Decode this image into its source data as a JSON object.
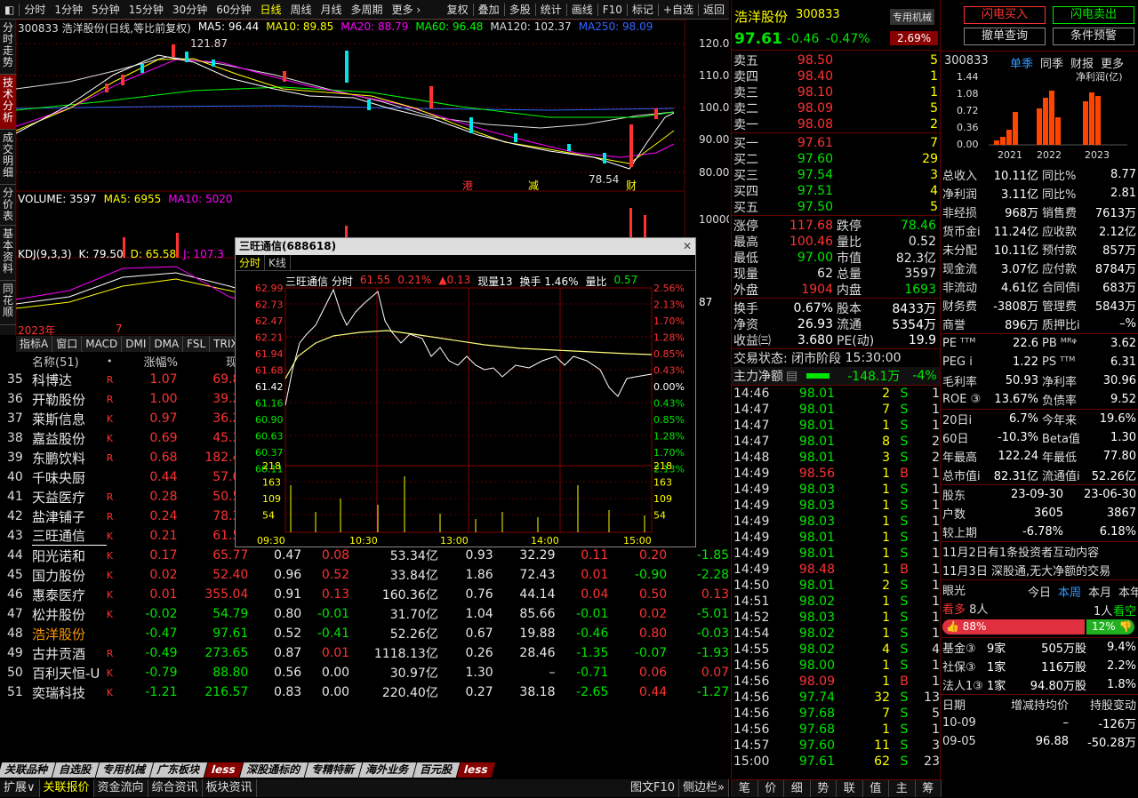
{
  "topbar": {
    "items": [
      "分时",
      "1分钟",
      "5分钟",
      "15分钟",
      "30分钟",
      "60分钟",
      "日线",
      "周线",
      "月线",
      "多周期",
      "更多"
    ],
    "tools": [
      "复权",
      "叠加",
      "多股",
      "统计",
      "画线",
      "F10",
      "标记",
      "+自选",
      "返回"
    ]
  },
  "lefttabs": [
    "分时走势",
    "技术分析",
    "成交明细",
    "分价表",
    "基本资料",
    "同花顺"
  ],
  "chart": {
    "title": "300833 浩洋股份(日线,等比前复权)",
    "ma": [
      {
        "name": "MA5: 96.44",
        "color": "#ffffff"
      },
      {
        "name": "MA10: 89.85",
        "color": "#ffff00"
      },
      {
        "name": "MA20: 88.79",
        "color": "#ff00ff"
      },
      {
        "name": "MA60: 96.48",
        "color": "#00ff00"
      },
      {
        "name": "MA120: 102.37",
        "color": "#e0e0e0"
      },
      {
        "name": "MA250: 98.09",
        "color": "#3366ff"
      }
    ],
    "yticks": [
      "120.00",
      "110.00",
      "100.00",
      "90.00",
      "80.00"
    ],
    "high": "121.87",
    "low": "78.54",
    "markers": [
      "港",
      "减",
      "财"
    ],
    "vol": "VOLUME: 3597",
    "vma5": "MA5: 6955",
    "vma10": "MA10: 5020",
    "vtick": "10000",
    "kdj": "KDJ(9,3,3)",
    "k": "K: 79.50",
    "d": "D: 65.58",
    "j": "J: 107.3",
    "year": "2023年",
    "month": "7",
    "right_price": "87"
  },
  "subtabs": [
    "指标A",
    "窗口",
    "MACD",
    "DMI",
    "DMA",
    "FSL",
    "TRIX"
  ],
  "list": {
    "headers": [
      "名称(51)",
      "•",
      "涨幅%",
      "现价"
    ],
    "rows": [
      {
        "n": "35",
        "name": "科博达",
        "tag": "R",
        "pct": "1.07",
        "price": "69.85",
        "a": "",
        "b": "",
        "cap": "",
        "d": "",
        "e": "",
        "f": "",
        "g": "",
        "h": ""
      },
      {
        "n": "36",
        "name": "开勒股份",
        "tag": "R",
        "pct": "1.00",
        "price": "39.29",
        "a": "",
        "b": "",
        "cap": "",
        "d": "",
        "e": "",
        "f": "",
        "g": "",
        "h": ""
      },
      {
        "n": "37",
        "name": "莱斯信息",
        "tag": "K",
        "pct": "0.97",
        "price": "36.25",
        "a": "",
        "b": "",
        "cap": "",
        "d": "",
        "e": "",
        "f": "",
        "g": "",
        "h": ""
      },
      {
        "n": "38",
        "name": "嘉益股份",
        "tag": "K",
        "pct": "0.69",
        "price": "45.30",
        "a": "",
        "b": "",
        "cap": "",
        "d": "",
        "e": "",
        "f": "",
        "g": "",
        "h": ""
      },
      {
        "n": "39",
        "name": "东鹏饮料",
        "tag": "R",
        "pct": "0.68",
        "price": "182.49",
        "a": "",
        "b": "",
        "cap": "",
        "d": "",
        "e": "",
        "f": "",
        "g": "",
        "h": ""
      },
      {
        "n": "40",
        "name": "千味央厨",
        "tag": "",
        "pct": "0.44",
        "price": "57.05",
        "a": "",
        "b": "",
        "cap": "",
        "d": "",
        "e": "",
        "f": "",
        "g": "",
        "h": ""
      },
      {
        "n": "41",
        "name": "天益医疗",
        "tag": "R",
        "pct": "0.28",
        "price": "50.55",
        "a": "",
        "b": "",
        "cap": "",
        "d": "",
        "e": "",
        "f": "",
        "g": "",
        "h": ""
      },
      {
        "n": "42",
        "name": "盐津铺子",
        "tag": "R",
        "pct": "0.24",
        "price": "78.37",
        "a": "",
        "b": "",
        "cap": "",
        "d": "",
        "e": "",
        "f": "",
        "g": "",
        "h": ""
      },
      {
        "n": "43",
        "name": "三旺通信",
        "tag": "K",
        "pct": "0.21",
        "price": "61.55",
        "a": "",
        "b": "",
        "cap": "",
        "d": "",
        "e": "",
        "f": "",
        "g": "",
        "h": ""
      },
      {
        "n": "44",
        "name": "阳光诺和",
        "tag": "K",
        "pct": "0.17",
        "price": "65.77",
        "a": "0.47",
        "b": "0.08",
        "cap": "53.34亿",
        "d": "0.93",
        "e": "32.29",
        "f": "0.11",
        "g": "0.20",
        "h": "-1.85"
      },
      {
        "n": "45",
        "name": "国力股份",
        "tag": "K",
        "pct": "0.02",
        "price": "52.40",
        "a": "0.96",
        "b": "0.52",
        "cap": "33.84亿",
        "d": "1.86",
        "e": "72.43",
        "f": "0.01",
        "g": "-0.90",
        "h": "-2.28"
      },
      {
        "n": "46",
        "name": "惠泰医疗",
        "tag": "K",
        "pct": "0.01",
        "price": "355.04",
        "a": "0.91",
        "b": "0.13",
        "cap": "160.36亿",
        "d": "0.76",
        "e": "44.14",
        "f": "0.04",
        "g": "0.50",
        "h": "0.13"
      },
      {
        "n": "47",
        "name": "松井股份",
        "tag": "K",
        "pct": "-0.02",
        "price": "54.79",
        "a": "0.80",
        "b": "-0.01",
        "cap": "31.70亿",
        "d": "1.04",
        "e": "85.66",
        "f": "-0.01",
        "g": "0.02",
        "h": "-5.01"
      },
      {
        "n": "48",
        "name": "浩洋股份",
        "tag": "",
        "pct": "-0.47",
        "price": "97.61",
        "a": "0.52",
        "b": "-0.41",
        "cap": "52.26亿",
        "d": "0.67",
        "e": "19.88",
        "f": "-0.46",
        "g": "0.80",
        "h": "-0.03"
      },
      {
        "n": "49",
        "name": "古井贡酒",
        "tag": "R",
        "pct": "-0.49",
        "price": "273.65",
        "a": "0.87",
        "b": "0.01",
        "cap": "1118.13亿",
        "d": "0.26",
        "e": "28.46",
        "f": "-1.35",
        "g": "-0.07",
        "h": "-1.93"
      },
      {
        "n": "50",
        "name": "百利天恒-U",
        "tag": "K",
        "pct": "-0.79",
        "price": "88.80",
        "a": "0.56",
        "b": "0.00",
        "cap": "30.97亿",
        "d": "1.30",
        "e": "–",
        "f": "-0.71",
        "g": "0.06",
        "h": "0.07"
      },
      {
        "n": "51",
        "name": "奕瑞科技",
        "tag": "K",
        "pct": "-1.21",
        "price": "216.57",
        "a": "0.83",
        "b": "0.00",
        "cap": "220.40亿",
        "d": "0.27",
        "e": "38.18",
        "f": "-2.65",
        "g": "0.44",
        "h": "-1.27"
      }
    ]
  },
  "btmtabs": [
    "关联品种",
    "自选股",
    "专用机械",
    "广东板块",
    "less",
    "深股通标的",
    "专精特新",
    "海外业务",
    "百元股",
    "less"
  ],
  "btm2": [
    "扩展∨",
    "关联报价",
    "资金流向",
    "综合资讯",
    "板块资讯"
  ],
  "btm2r": [
    "图文F10",
    "侧边栏»"
  ],
  "popup": {
    "title": "三旺通信(688618)",
    "tabs": [
      "分时",
      "K线"
    ],
    "info": "三旺通信 分时",
    "price": "61.55",
    "pct": "0.21%",
    "chg": "▲0.13",
    "vol": "现量13",
    "turn": "换手 1.46%",
    "vr": "量比",
    "vrv": "0.57",
    "lticks": [
      "62.99",
      "62.73",
      "62.47",
      "62.21",
      "61.94",
      "61.68",
      "61.42",
      "61.16",
      "60.90",
      "60.63",
      "60.37",
      "60.11"
    ],
    "rticks": [
      "2.56%",
      "2.13%",
      "1.70%",
      "1.28%",
      "0.85%",
      "0.43%",
      "0.00%",
      "0.43%",
      "0.85%",
      "1.28%",
      "1.70%",
      "2.13%"
    ],
    "vticks": [
      "218",
      "163",
      "109",
      "54"
    ],
    "times": [
      "09:30",
      "10:30",
      "13:00",
      "14:00",
      "15:00"
    ]
  },
  "stock": {
    "name": "浩洋股份",
    "code": "300833",
    "badge": "专用机械",
    "price": "97.61",
    "chg": "-0.46",
    "pct": "-0.47%",
    "badgepct": "2.69%"
  },
  "asks": [
    {
      "l": "卖五",
      "p": "98.50",
      "v": "5"
    },
    {
      "l": "卖四",
      "p": "98.40",
      "v": "1"
    },
    {
      "l": "卖三",
      "p": "98.10",
      "v": "1"
    },
    {
      "l": "卖二",
      "p": "98.09",
      "v": "5"
    },
    {
      "l": "卖一",
      "p": "98.08",
      "v": "2"
    }
  ],
  "bids": [
    {
      "l": "买一",
      "p": "97.61",
      "v": "7"
    },
    {
      "l": "买二",
      "p": "97.60",
      "v": "29"
    },
    {
      "l": "买三",
      "p": "97.54",
      "v": "3"
    },
    {
      "l": "买四",
      "p": "97.51",
      "v": "4"
    },
    {
      "l": "买五",
      "p": "97.50",
      "v": "5"
    }
  ],
  "quote": [
    {
      "a": "涨停",
      "av": "117.68",
      "ac": "red",
      "b": "跌停",
      "bv": "78.46",
      "bc": "grn"
    },
    {
      "a": "最高",
      "av": "100.46",
      "ac": "red",
      "b": "量比",
      "bv": "0.52",
      "bc": "wht"
    },
    {
      "a": "最低",
      "av": "97.00",
      "ac": "grn",
      "b": "市值",
      "bv": "82.3亿",
      "bc": "wht"
    },
    {
      "a": "现量",
      "av": "62",
      "ac": "wht",
      "b": "总量",
      "bv": "3597",
      "bc": "wht"
    },
    {
      "a": "外盘",
      "av": "1904",
      "ac": "red",
      "b": "内盘",
      "bv": "1693",
      "bc": "grn"
    }
  ],
  "quote2": [
    {
      "a": "换手",
      "av": "0.67%",
      "b": "股本",
      "bv": "8433万"
    },
    {
      "a": "净资",
      "av": "26.93",
      "b": "流通",
      "bv": "5354万"
    },
    {
      "a": "收益㈢",
      "av": "3.680",
      "b": "PE(动)",
      "bv": "19.9"
    }
  ],
  "status": {
    "label": "交易状态: 闭市阶段",
    "time": "15:30:00",
    "flow_label": "主力净额",
    "flow": "-148.1万",
    "flow_pct": "-4%"
  },
  "ticks": [
    [
      "14:46",
      "98.01",
      "2",
      "S",
      "1"
    ],
    [
      "14:47",
      "98.01",
      "7",
      "S",
      "1"
    ],
    [
      "14:47",
      "98.01",
      "1",
      "S",
      "1"
    ],
    [
      "14:47",
      "98.01",
      "8",
      "S",
      "2"
    ],
    [
      "14:48",
      "98.01",
      "3",
      "S",
      "2"
    ],
    [
      "14:49",
      "98.56",
      "1",
      "B",
      "1"
    ],
    [
      "14:49",
      "98.03",
      "1",
      "S",
      "1"
    ],
    [
      "14:49",
      "98.03",
      "1",
      "S",
      "1"
    ],
    [
      "14:49",
      "98.03",
      "1",
      "S",
      "1"
    ],
    [
      "14:49",
      "98.01",
      "1",
      "S",
      "1"
    ],
    [
      "14:49",
      "98.01",
      "1",
      "S",
      "1"
    ],
    [
      "14:49",
      "98.48",
      "1",
      "B",
      "1"
    ],
    [
      "14:50",
      "98.01",
      "2",
      "S",
      "1"
    ],
    [
      "14:51",
      "98.02",
      "1",
      "S",
      "1"
    ],
    [
      "14:52",
      "98.03",
      "1",
      "S",
      "1"
    ],
    [
      "14:54",
      "98.02",
      "1",
      "S",
      "1"
    ],
    [
      "14:55",
      "98.02",
      "4",
      "S",
      "4"
    ],
    [
      "14:56",
      "98.00",
      "1",
      "S",
      "1"
    ],
    [
      "14:56",
      "98.09",
      "1",
      "B",
      "1"
    ],
    [
      "14:56",
      "97.74",
      "32",
      "S",
      "13"
    ],
    [
      "14:56",
      "97.68",
      "7",
      "S",
      "5"
    ],
    [
      "14:56",
      "97.68",
      "1",
      "S",
      "1"
    ],
    [
      "14:57",
      "97.60",
      "11",
      "S",
      "3"
    ],
    [
      "15:00",
      "97.61",
      "62",
      "S",
      "23"
    ]
  ],
  "midbottom": [
    "笔",
    "价",
    "细",
    "势",
    "联",
    "值",
    "主",
    "筹"
  ],
  "right": {
    "btns": [
      "闪电买入",
      "闪电卖出",
      "撤单查询",
      "条件预警"
    ],
    "code": "300833",
    "tabs": [
      "单季",
      "同季",
      "财报",
      "更多"
    ],
    "chart_label": "净利润(亿)",
    "yticks": [
      "1.44",
      "1.08",
      "0.72",
      "0.36",
      "0.00"
    ],
    "years": [
      "2021",
      "2022",
      "2023"
    ],
    "fin": [
      [
        "总收入",
        "10.11亿",
        "同比%",
        "8.77"
      ],
      [
        "净利润",
        "3.11亿",
        "同比%",
        "2.81"
      ],
      [
        "非经损",
        "968万",
        "销售费",
        "7613万"
      ],
      [
        "货币金i",
        "11.24亿",
        "应收款",
        "2.12亿"
      ],
      [
        "未分配",
        "10.11亿",
        "预付款",
        "857万"
      ],
      [
        "现金流",
        "3.07亿",
        "应付款",
        "8784万"
      ],
      [
        "非流动",
        "4.61亿",
        "合同债i",
        "683万"
      ],
      [
        "财务费",
        "-3808万",
        "管理费",
        "5843万"
      ],
      [
        "商誉",
        "896万",
        "质押比i",
        "–%"
      ]
    ],
    "ratios": [
      [
        "PE ᵀᵀᴹ",
        "22.6",
        "PB ᴹᴿᵠ",
        "3.62"
      ],
      [
        "PEG i",
        "1.22",
        "PS ᵀᵀᴹ",
        "6.31"
      ],
      [
        "毛利率",
        "50.93",
        "净利率",
        "30.96"
      ],
      [
        "ROE ③",
        "13.67%",
        "负债率",
        "9.52"
      ]
    ],
    "perf": [
      [
        "20日i",
        "6.7%",
        "今年来",
        "19.6%"
      ],
      [
        "60日",
        "-10.3%",
        "Beta值",
        "1.30"
      ],
      [
        "年最高",
        "122.24",
        "年最低",
        "77.80"
      ],
      [
        "总市值i",
        "82.31亿",
        "流通值i",
        "52.26亿"
      ]
    ],
    "holders": [
      [
        "股东",
        "23-09-30",
        "23-06-30"
      ],
      [
        "户数",
        "3605",
        "3867"
      ],
      [
        "较上期",
        "-6.78%",
        "6.18%"
      ]
    ],
    "news": [
      "11月2日有1条投资者互动内容",
      "11月3日 深股通,无大净额的交易"
    ],
    "opinion": {
      "label": "眼光",
      "tabs": [
        "今日",
        "本周",
        "本月",
        "本年"
      ],
      "bull": "看多",
      "bulln": "8人",
      "bear": "1人",
      "beartxt": "看空",
      "bullpct": "88%",
      "bearpct": "12%"
    },
    "inst": [
      [
        "基金③",
        "9家",
        "505万股",
        "9.4%"
      ],
      [
        "社保③",
        "1家",
        "116万股",
        "2.2%"
      ],
      [
        "法人1③",
        "1家",
        "94.80万股",
        "1.8%"
      ]
    ],
    "chg": {
      "headers": [
        "日期",
        "增减持均价",
        "持股变动"
      ],
      "rows": [
        [
          "10-09",
          "–",
          "-126万"
        ],
        [
          "09-05",
          "96.88",
          "-50.28万"
        ]
      ]
    }
  }
}
